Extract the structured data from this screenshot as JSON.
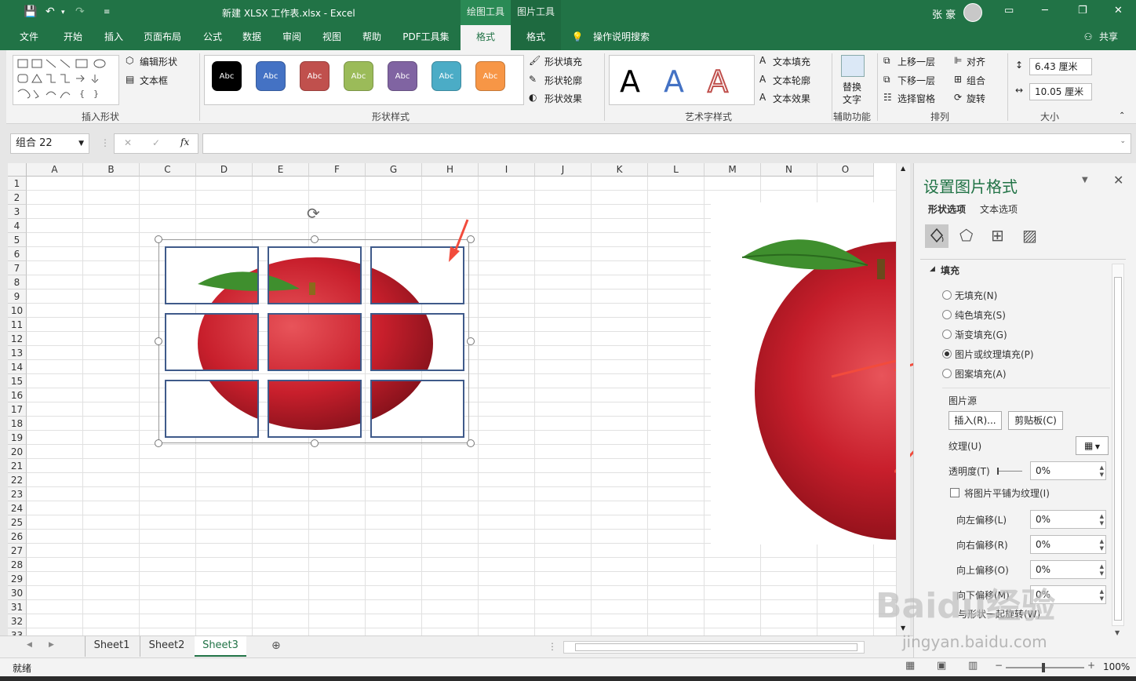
{
  "titlebar": {
    "doc_title": "新建 XLSX 工作表.xlsx  -  Excel",
    "ctx_drawing_tools": "绘图工具",
    "ctx_picture_tools": "图片工具",
    "user": "张 豪"
  },
  "tabs": [
    "文件",
    "开始",
    "插入",
    "页面布局",
    "公式",
    "数据",
    "审阅",
    "视图",
    "帮助",
    "PDF工具集",
    "格式",
    "格式"
  ],
  "tell_me": "操作说明搜索",
  "share": "共享",
  "ribbon": {
    "insert_shapes": {
      "edit_shape": "编辑形状",
      "textbox": "文本框",
      "label": "插入形状"
    },
    "shape_styles": {
      "swatch_text": "Abc",
      "fill": "形状填充",
      "outline": "形状轮廓",
      "effect": "形状效果",
      "label": "形状样式",
      "swatches": [
        "#000000",
        "#4472c4",
        "#c0504d",
        "#9bbb59",
        "#8064a2",
        "#4bacc6",
        "#f79646"
      ]
    },
    "wordart": {
      "letter": "A",
      "text_fill": "文本填充",
      "text_outline": "文本轮廓",
      "text_effect": "文本效果",
      "label": "艺术字样式"
    },
    "accessibility": {
      "alt_text": "替换",
      "alt_text2": "文字",
      "label": "辅助功能"
    },
    "arrange": {
      "bring_forward": "上移一层",
      "send_backward": "下移一层",
      "selection_pane": "选择窗格",
      "align": "对齐",
      "group": "组合",
      "rotate": "旋转",
      "label": "排列"
    },
    "size": {
      "height": "6.43 厘米",
      "width": "10.05 厘米",
      "label": "大小"
    }
  },
  "formula": {
    "name_box": "组合 22",
    "fx": "fx",
    "cancel": "✕",
    "confirm": "✓"
  },
  "grid": {
    "columns": [
      "A",
      "B",
      "C",
      "D",
      "E",
      "F",
      "G",
      "H",
      "I",
      "J",
      "K",
      "L",
      "M",
      "N",
      "O"
    ],
    "rows": [
      "1",
      "2",
      "3",
      "4",
      "5",
      "6",
      "7",
      "8",
      "9",
      "10",
      "11",
      "12",
      "13",
      "14",
      "15",
      "16",
      "17",
      "18",
      "19",
      "20",
      "21",
      "22",
      "23",
      "24",
      "25",
      "26",
      "27",
      "28",
      "29",
      "30",
      "31",
      "32",
      "33"
    ]
  },
  "sheets": [
    "Sheet1",
    "Sheet2",
    "Sheet3"
  ],
  "status": {
    "ready": "就绪",
    "zoom": "100%"
  },
  "pane": {
    "title": "设置图片格式",
    "tab_shape": "形状选项",
    "tab_text": "文本选项",
    "fill_header": "填充",
    "fill_options": [
      "无填充(N)",
      "纯色填充(S)",
      "渐变填充(G)",
      "图片或纹理填充(P)",
      "图案填充(A)"
    ],
    "selected_fill": 3,
    "picture_source": "图片源",
    "insert_btn": "插入(R)...",
    "clipboard_btn": "剪贴板(C)",
    "texture": "纹理(U)",
    "transparency": "透明度(T)",
    "transparency_value": "0%",
    "tile_checkbox": "将图片平铺为纹理(I)",
    "offsets": [
      {
        "label": "向左偏移(L)",
        "value": "0%"
      },
      {
        "label": "向右偏移(R)",
        "value": "0%"
      },
      {
        "label": "向上偏移(O)",
        "value": "0%"
      },
      {
        "label": "向下偏移(M)",
        "value": "0%"
      }
    ],
    "rotate_with_shape": "与形状一起旋转(W)"
  },
  "watermark": {
    "brand": "Baidu经验",
    "url": "jingyan.baidu.com"
  }
}
